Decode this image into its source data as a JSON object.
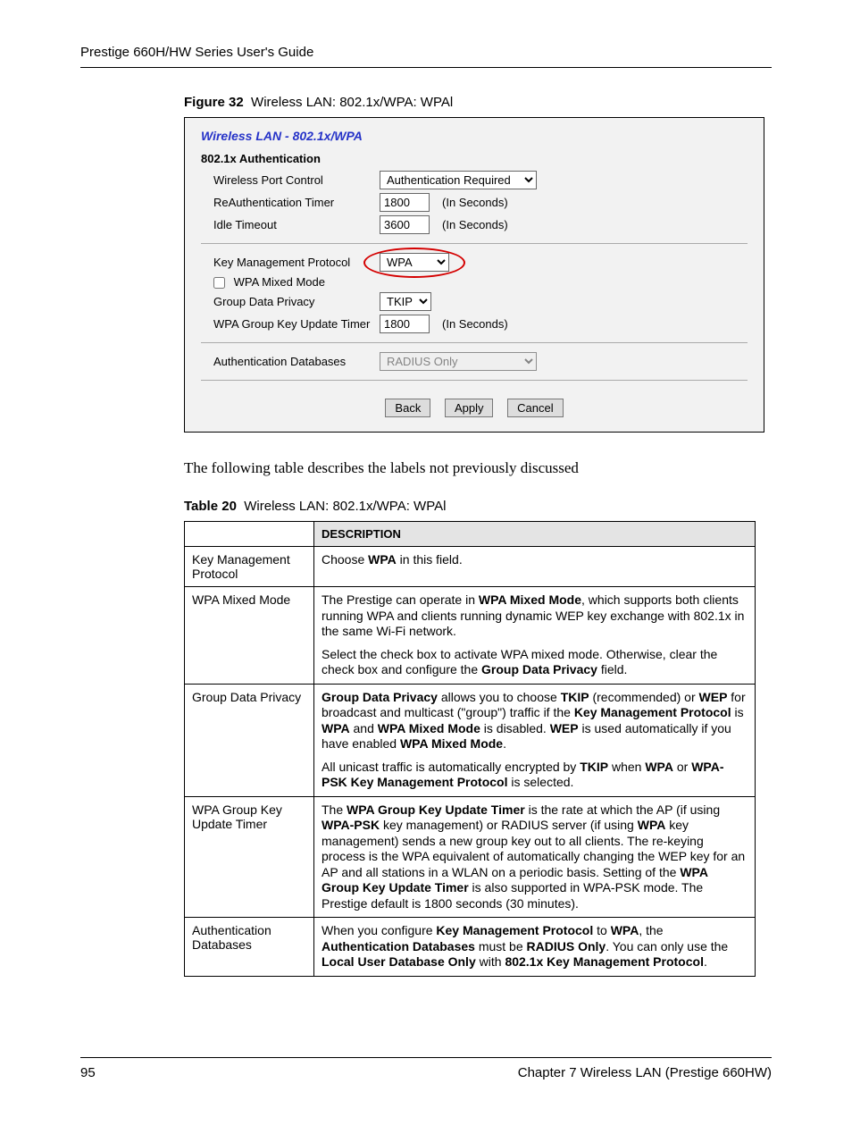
{
  "header": "Prestige 660H/HW Series User's Guide",
  "figure": {
    "label": "Figure 32",
    "title": "Wireless LAN: 802.1x/WPA: WPAl"
  },
  "shot": {
    "title": "Wireless LAN - 802.1x/WPA",
    "section_auth": "802.1x Authentication",
    "wpc": {
      "label": "Wireless Port Control",
      "value": "Authentication Required"
    },
    "reauth": {
      "label": "ReAuthentication Timer",
      "value": "1800",
      "unit": "(In Seconds)"
    },
    "idle": {
      "label": "Idle Timeout",
      "value": "3600",
      "unit": "(In Seconds)"
    },
    "kmp": {
      "label": "Key Management Protocol",
      "value": "WPA"
    },
    "mixed": {
      "label": "WPA Mixed Mode"
    },
    "gdp": {
      "label": "Group Data Privacy",
      "value": "TKIP"
    },
    "gku": {
      "label": "WPA Group Key Update Timer",
      "value": "1800",
      "unit": "(In Seconds)"
    },
    "authdb": {
      "label": "Authentication Databases",
      "value": "RADIUS Only"
    },
    "buttons": {
      "back": "Back",
      "apply": "Apply",
      "cancel": "Cancel"
    }
  },
  "intro": "The following table describes the labels not previously discussed",
  "table_caption": {
    "label": "Table 20",
    "title": "Wireless LAN: 802.1x/WPA: WPAl"
  },
  "table": {
    "header_desc": "Description",
    "rows": [
      {
        "name": "Key Management Protocol",
        "desc": [
          {
            "t": "Choose <b>WPA</b> in this field."
          }
        ]
      },
      {
        "name": "WPA Mixed Mode",
        "desc": [
          {
            "t": "The Prestige can operate in <b>WPA Mixed Mode</b>, which supports both clients running WPA and clients running dynamic WEP key exchange with 802.1x in the same Wi-Fi network."
          },
          {
            "t": "Select the check box to activate WPA mixed mode. Otherwise, clear the check box and configure the <b>Group Data Privacy</b> field."
          }
        ]
      },
      {
        "name": "Group Data Privacy",
        "desc": [
          {
            "t": "<b>Group Data Privacy</b> allows you to choose <b>TKIP</b> (recommended) or <b>WEP</b> for broadcast and multicast (\"group\") traffic if the <b>Key Management Protocol</b> is <b>WPA</b> and <b>WPA Mixed Mode</b> is disabled. <b>WEP</b> is used automatically if you have enabled <b>WPA Mixed Mode</b>."
          },
          {
            "t": "All unicast traffic is automatically encrypted by <b>TKIP</b> when <b>WPA</b> or <b>WPA-PSK Key Management Protocol</b> is selected."
          }
        ]
      },
      {
        "name": "WPA Group Key Update Timer",
        "desc": [
          {
            "t": "The <b>WPA Group Key Update Timer</b> is the rate at which the AP (if using <b>WPA-PSK</b> key management) or RADIUS server (if using <b>WPA</b> key management) sends a new group key out to all clients. The re-keying process is the WPA equivalent of automatically changing the WEP key for an AP and all stations in a WLAN on a periodic basis. Setting of the <b>WPA Group Key Update Timer</b> is also supported in WPA-PSK mode. The Prestige default is 1800 seconds (30 minutes)."
          }
        ]
      },
      {
        "name": "Authentication Databases",
        "desc": [
          {
            "t": "When you configure <b>Key Management Protocol</b> to <b>WPA</b>, the <b>Authentication Databases</b> must be <b>RADIUS Only</b>. You can only use the <b>Local User Database Only</b> with <b>802.1x Key Management Protocol</b>."
          }
        ]
      }
    ]
  },
  "footer": {
    "page": "95",
    "chapter": "Chapter 7 Wireless LAN (Prestige 660HW)"
  }
}
